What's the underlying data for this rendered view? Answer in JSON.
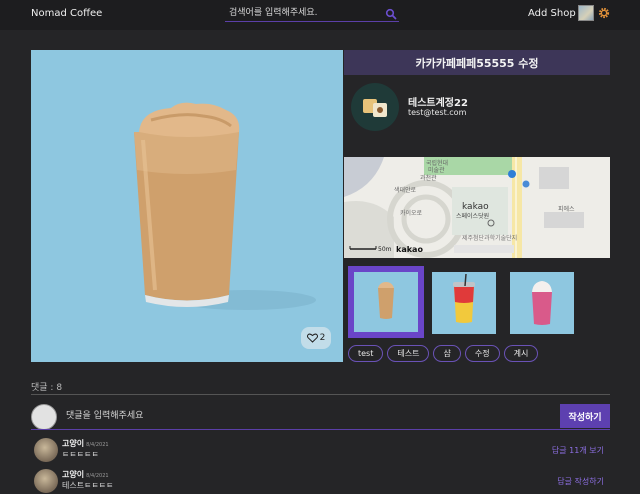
{
  "header": {
    "logo": "Nomad Coffee",
    "search_placeholder": "검색어를 입력해주세요.",
    "add_shop": "Add Shop"
  },
  "shop": {
    "title": "카카카페페페55555 수정",
    "likes": "2",
    "owner_name": "테스트계정22",
    "owner_email": "test@test.com"
  },
  "map": {
    "labels": [
      "국립현대",
      "미술관",
      "과천관",
      "색대안로",
      "카이오로",
      "kakao",
      "스페이스닷원",
      "제주첨단과학기술단지",
      "피에스"
    ],
    "scale_label": "50m",
    "brand": "kakao"
  },
  "tags": [
    "test",
    "테스트",
    "샵",
    "수정",
    "계시"
  ],
  "comments": {
    "count_label": "댓글 : 8",
    "input_placeholder": "댓글을 입력해주세요",
    "submit_label": "작성하기",
    "items": [
      {
        "author": "고양이",
        "date": "8/4/2021",
        "text": "ㅌㅌㅌㅌㅌ",
        "action": "답글 11개 보기"
      },
      {
        "author": "고양이",
        "date": "8/4/2021",
        "text": "테스트ㅌㅌㅌㅌ",
        "action": "답글 작성하기"
      }
    ]
  },
  "colors": {
    "accent": "#5d40b0",
    "background": "#252527",
    "hero_bg": "#8ec7e0"
  }
}
